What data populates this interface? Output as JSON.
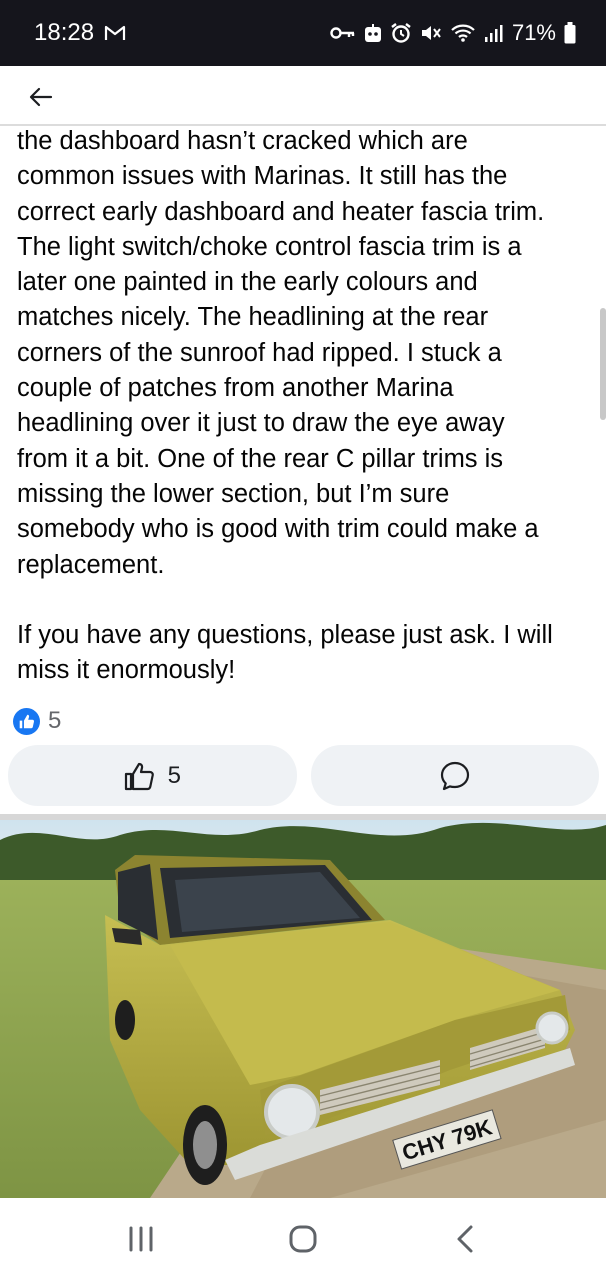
{
  "status_bar": {
    "time": "18:28",
    "battery_percent": "71%",
    "icons": [
      "gmail-icon",
      "key-icon",
      "robot-icon",
      "alarm-icon",
      "mute-icon",
      "wifi-icon",
      "signal-icon",
      "battery-icon"
    ]
  },
  "header": {
    "back_icon": "arrow-left-icon"
  },
  "post": {
    "lines_para1": [
      "the dashboard hasn’t cracked which are",
      "common issues with Marinas. It still has the",
      "correct early dashboard and heater fascia trim.",
      "The light switch/choke control fascia trim is a",
      "later one painted in the early colours and",
      "matches nicely. The headlining at the rear",
      "corners of the sunroof had ripped. I stuck a",
      "couple of patches from another Marina",
      "headlining over it just to draw the eye away",
      "from it a bit. One of the rear C pillar trims is",
      "missing the lower section, but I’m sure",
      "somebody who is good with trim could make a",
      "replacement."
    ],
    "lines_para2": [
      "If you have any questions, please just ask. I will",
      "miss it enormously!"
    ]
  },
  "reactions": {
    "summary_count": "5",
    "like_button_count": "5"
  },
  "photo": {
    "plate_text": "CHY 79K",
    "car_color": "#b4ab3c"
  },
  "nav": {
    "recents_icon": "recents-icon",
    "home_icon": "home-icon",
    "back_icon": "back-chevron-icon"
  },
  "colors": {
    "accent": "#1877f2",
    "button_bg": "#eff2f5",
    "status_bar_bg": "#15151c"
  }
}
